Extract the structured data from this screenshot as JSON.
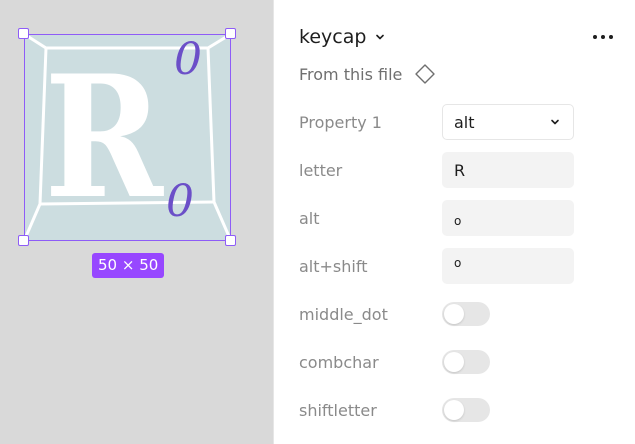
{
  "canvas": {
    "size_badge": "50 × 50",
    "keycap": {
      "main_letter": "R",
      "alt_glyph": "0",
      "shift_glyph": "0"
    }
  },
  "panel": {
    "component_name": "keycap",
    "source_label": "From this file",
    "properties": [
      {
        "label": "Property 1",
        "type": "select",
        "value": "alt"
      },
      {
        "label": "letter",
        "type": "text",
        "value": "R"
      },
      {
        "label": "alt",
        "type": "text",
        "value": "o"
      },
      {
        "label": "alt+shift",
        "type": "text",
        "value": "o"
      },
      {
        "label": "middle_dot",
        "type": "toggle",
        "value": false
      },
      {
        "label": "combchar",
        "type": "toggle",
        "value": false
      },
      {
        "label": "shiftletter",
        "type": "toggle",
        "value": false
      }
    ]
  },
  "colors": {
    "selection": "#8e5cf7",
    "badge": "#9747ff",
    "keycap_fill": "#ccdde0",
    "glyph": "#6b4fc8"
  }
}
